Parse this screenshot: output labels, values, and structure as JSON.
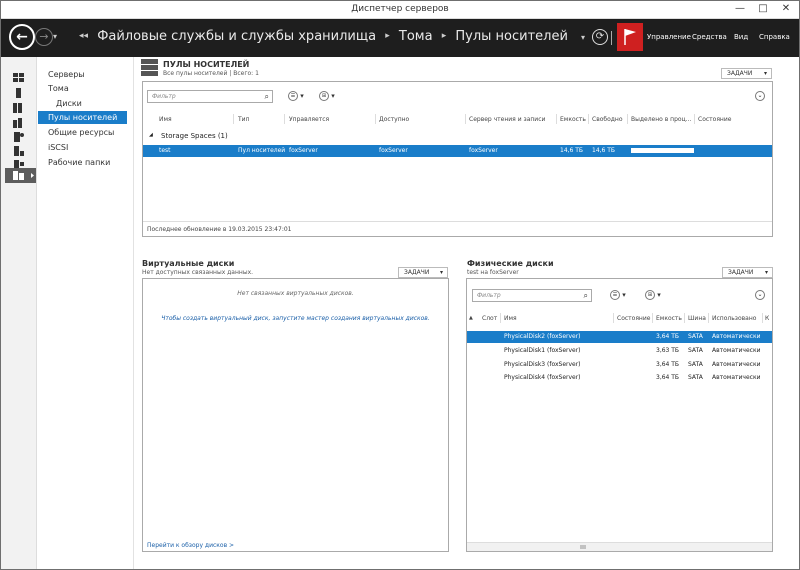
{
  "window": {
    "title": "Диспетчер серверов"
  },
  "window_controls": {
    "minimize": "—",
    "maximize": "□",
    "close": "✕"
  },
  "nav": {
    "back": "←",
    "forward": "→",
    "dropdown": "▾",
    "breadcrumb": [
      "Файловые службы и службы хранилища",
      "Тома",
      "Пулы носителей"
    ],
    "breadcrumb_lead": "◂◂",
    "breadcrumb_sep": "▸",
    "refresh": "⟳",
    "menus": [
      "Управление",
      "Средства",
      "Вид",
      "Справка"
    ]
  },
  "sidebar_icons": [
    "dashboard-icon",
    "local-server-icon",
    "all-servers-icon",
    "ad-icon",
    "dns-icon",
    "file-server-icon",
    "iis-icon",
    "file-storage-icon"
  ],
  "subnav": {
    "items": [
      "Серверы",
      "Тома",
      "Диски",
      "Пулы носителей",
      "Общие ресурсы",
      "iSCSI",
      "Рабочие папки"
    ]
  },
  "pools": {
    "title": "ПУЛЫ НОСИТЕЛЕЙ",
    "subtitle": "Все пулы носителей | Всего: 1",
    "tasks": "ЗАДАЧИ",
    "filter_placeholder": "Фильтр",
    "columns": [
      "Имя",
      "Тип",
      "Управляется",
      "Доступно",
      "Сервер чтения и записи",
      "Емкость",
      "Свободно",
      "Выделено в проц...",
      "Состояние"
    ],
    "group": "Storage Spaces (1)",
    "row": {
      "name": "test",
      "type": "Пул носителей",
      "managed": "foxServer",
      "available": "foxServer",
      "rw_server": "foxServer",
      "capacity": "14,6 ТБ",
      "free": "14,6 ТБ",
      "allocated_percent": 0,
      "status": ""
    },
    "last_update": "Последнее обновление в 19.03.2015 23:47:01"
  },
  "virtual_disks": {
    "title": "Виртуальные диски",
    "subtitle": "Нет доступных связанных данных.",
    "tasks": "ЗАДАЧИ",
    "empty_line1": "Нет связанных виртуальных дисков.",
    "empty_line2": "Чтобы создать виртуальный диск, запустите мастер создания виртуальных дисков.",
    "link": "Перейти к обзору дисков >"
  },
  "physical_disks": {
    "title": "Физические диски",
    "subtitle": "test на foxServer",
    "tasks": "ЗАДАЧИ",
    "filter_placeholder": "Фильтр",
    "columns": [
      "Слот",
      "Имя",
      "Состояние",
      "Емкость",
      "Шина",
      "Использовано",
      "К"
    ],
    "rows": [
      {
        "name": "PhysicalDisk2 (foxServer)",
        "capacity": "3,64 ТБ",
        "bus": "SATA",
        "usage": "Автоматически"
      },
      {
        "name": "PhysicalDisk1 (foxServer)",
        "capacity": "3,63 ТБ",
        "bus": "SATA",
        "usage": "Автоматически"
      },
      {
        "name": "PhysicalDisk3 (foxServer)",
        "capacity": "3,64 ТБ",
        "bus": "SATA",
        "usage": "Автоматически"
      },
      {
        "name": "PhysicalDisk4 (foxServer)",
        "capacity": "3,64 ТБ",
        "bus": "SATA",
        "usage": "Автоматически"
      }
    ]
  },
  "colors": {
    "accent": "#1a7dc9",
    "nav_bg": "#1e1e1e",
    "flag": "#cf2020"
  }
}
